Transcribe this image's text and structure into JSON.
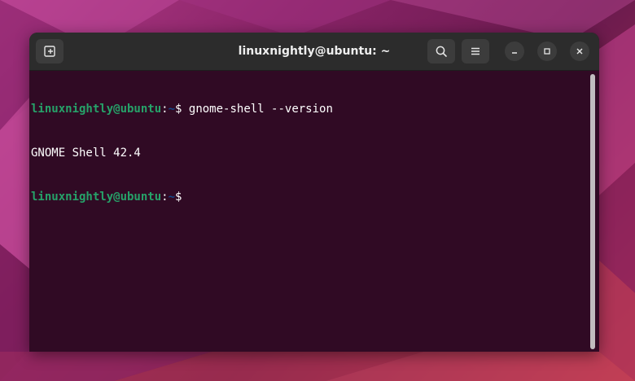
{
  "window": {
    "title": "linuxnightly@ubuntu: ~"
  },
  "terminal": {
    "lines": [
      {
        "user": "linuxnightly@ubuntu",
        "colon": ":",
        "path": "~",
        "dollar": "$ ",
        "command": "gnome-shell --version"
      },
      {
        "output": "GNOME Shell 42.4"
      },
      {
        "user": "linuxnightly@ubuntu",
        "colon": ":",
        "path": "~",
        "dollar": "$",
        "command": ""
      }
    ]
  },
  "colors": {
    "terminal_bg": "#300a24",
    "prompt_user": "#26a269",
    "prompt_path": "#12488b",
    "titlebar_bg": "#2c2c2c",
    "text": "#ffffff"
  },
  "icons": {
    "new_tab": "new-tab-icon",
    "search": "search-icon",
    "menu": "hamburger-menu-icon",
    "minimize": "minimize-icon",
    "maximize": "maximize-icon",
    "close": "close-icon"
  }
}
